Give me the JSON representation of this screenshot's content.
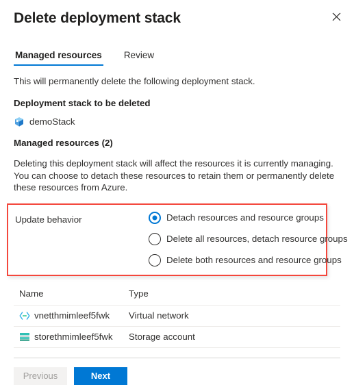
{
  "panel": {
    "title": "Delete deployment stack",
    "close_icon": "close-icon"
  },
  "tabs": [
    {
      "label": "Managed resources",
      "active": true
    },
    {
      "label": "Review",
      "active": false
    }
  ],
  "body": {
    "intro": "This will permanently delete the following deployment stack.",
    "stack_section_label": "Deployment stack to be deleted",
    "stack_icon": "deployment-stack-icon",
    "stack_name": "demoStack",
    "managed_resources_label": "Managed resources (2)",
    "description": "Deleting this deployment stack will affect the resources it is currently managing. You can choose to detach these resources to retain them or permanently delete these resources from Azure."
  },
  "update_behavior": {
    "label": "Update behavior",
    "highlight_color": "#f4473c",
    "accent_color": "#0078d4",
    "options": [
      {
        "label": "Detach resources and resource groups",
        "selected": true
      },
      {
        "label": "Delete all resources, detach resource groups",
        "selected": false
      },
      {
        "label": "Delete both resources and resource groups",
        "selected": false
      }
    ]
  },
  "table": {
    "columns": [
      "Name",
      "Type"
    ],
    "rows": [
      {
        "icon": "virtual-network-icon",
        "name": "vnetthmimleef5fwk",
        "type": "Virtual network"
      },
      {
        "icon": "storage-account-icon",
        "name": "storethmimleef5fwk",
        "type": "Storage account"
      }
    ]
  },
  "footer": {
    "previous_label": "Previous",
    "next_label": "Next"
  }
}
